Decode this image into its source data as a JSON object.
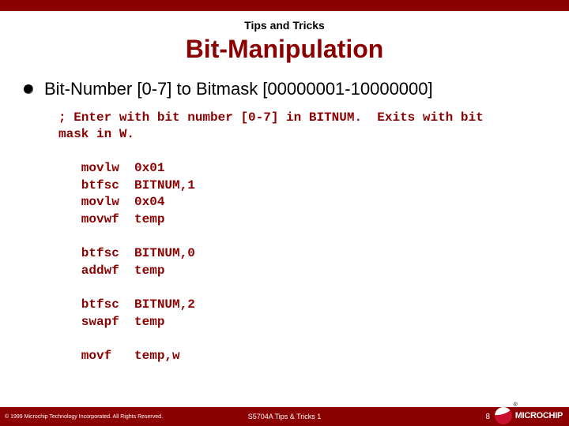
{
  "header_label": "Tips and Tricks",
  "title": "Bit-Manipulation",
  "bullet_text": "Bit-Number [0-7] to Bitmask [00000001-10000000]",
  "code": "; Enter with bit number [0-7] in BITNUM.  Exits with bit\nmask in W.\n\n   movlw  0x01\n   btfsc  BITNUM,1\n   movlw  0x04\n   movwf  temp\n\n   btfsc  BITNUM,0\n   addwf  temp\n\n   btfsc  BITNUM,2\n   swapf  temp\n\n   movf   temp,w",
  "footer": {
    "copyright": "© 1999 Microchip Technology Incorporated. All Rights Reserved.",
    "center": "S5704A Tips & Tricks 1",
    "page": "8"
  },
  "logo": {
    "text": "MICROCHIP",
    "reg": "®"
  }
}
